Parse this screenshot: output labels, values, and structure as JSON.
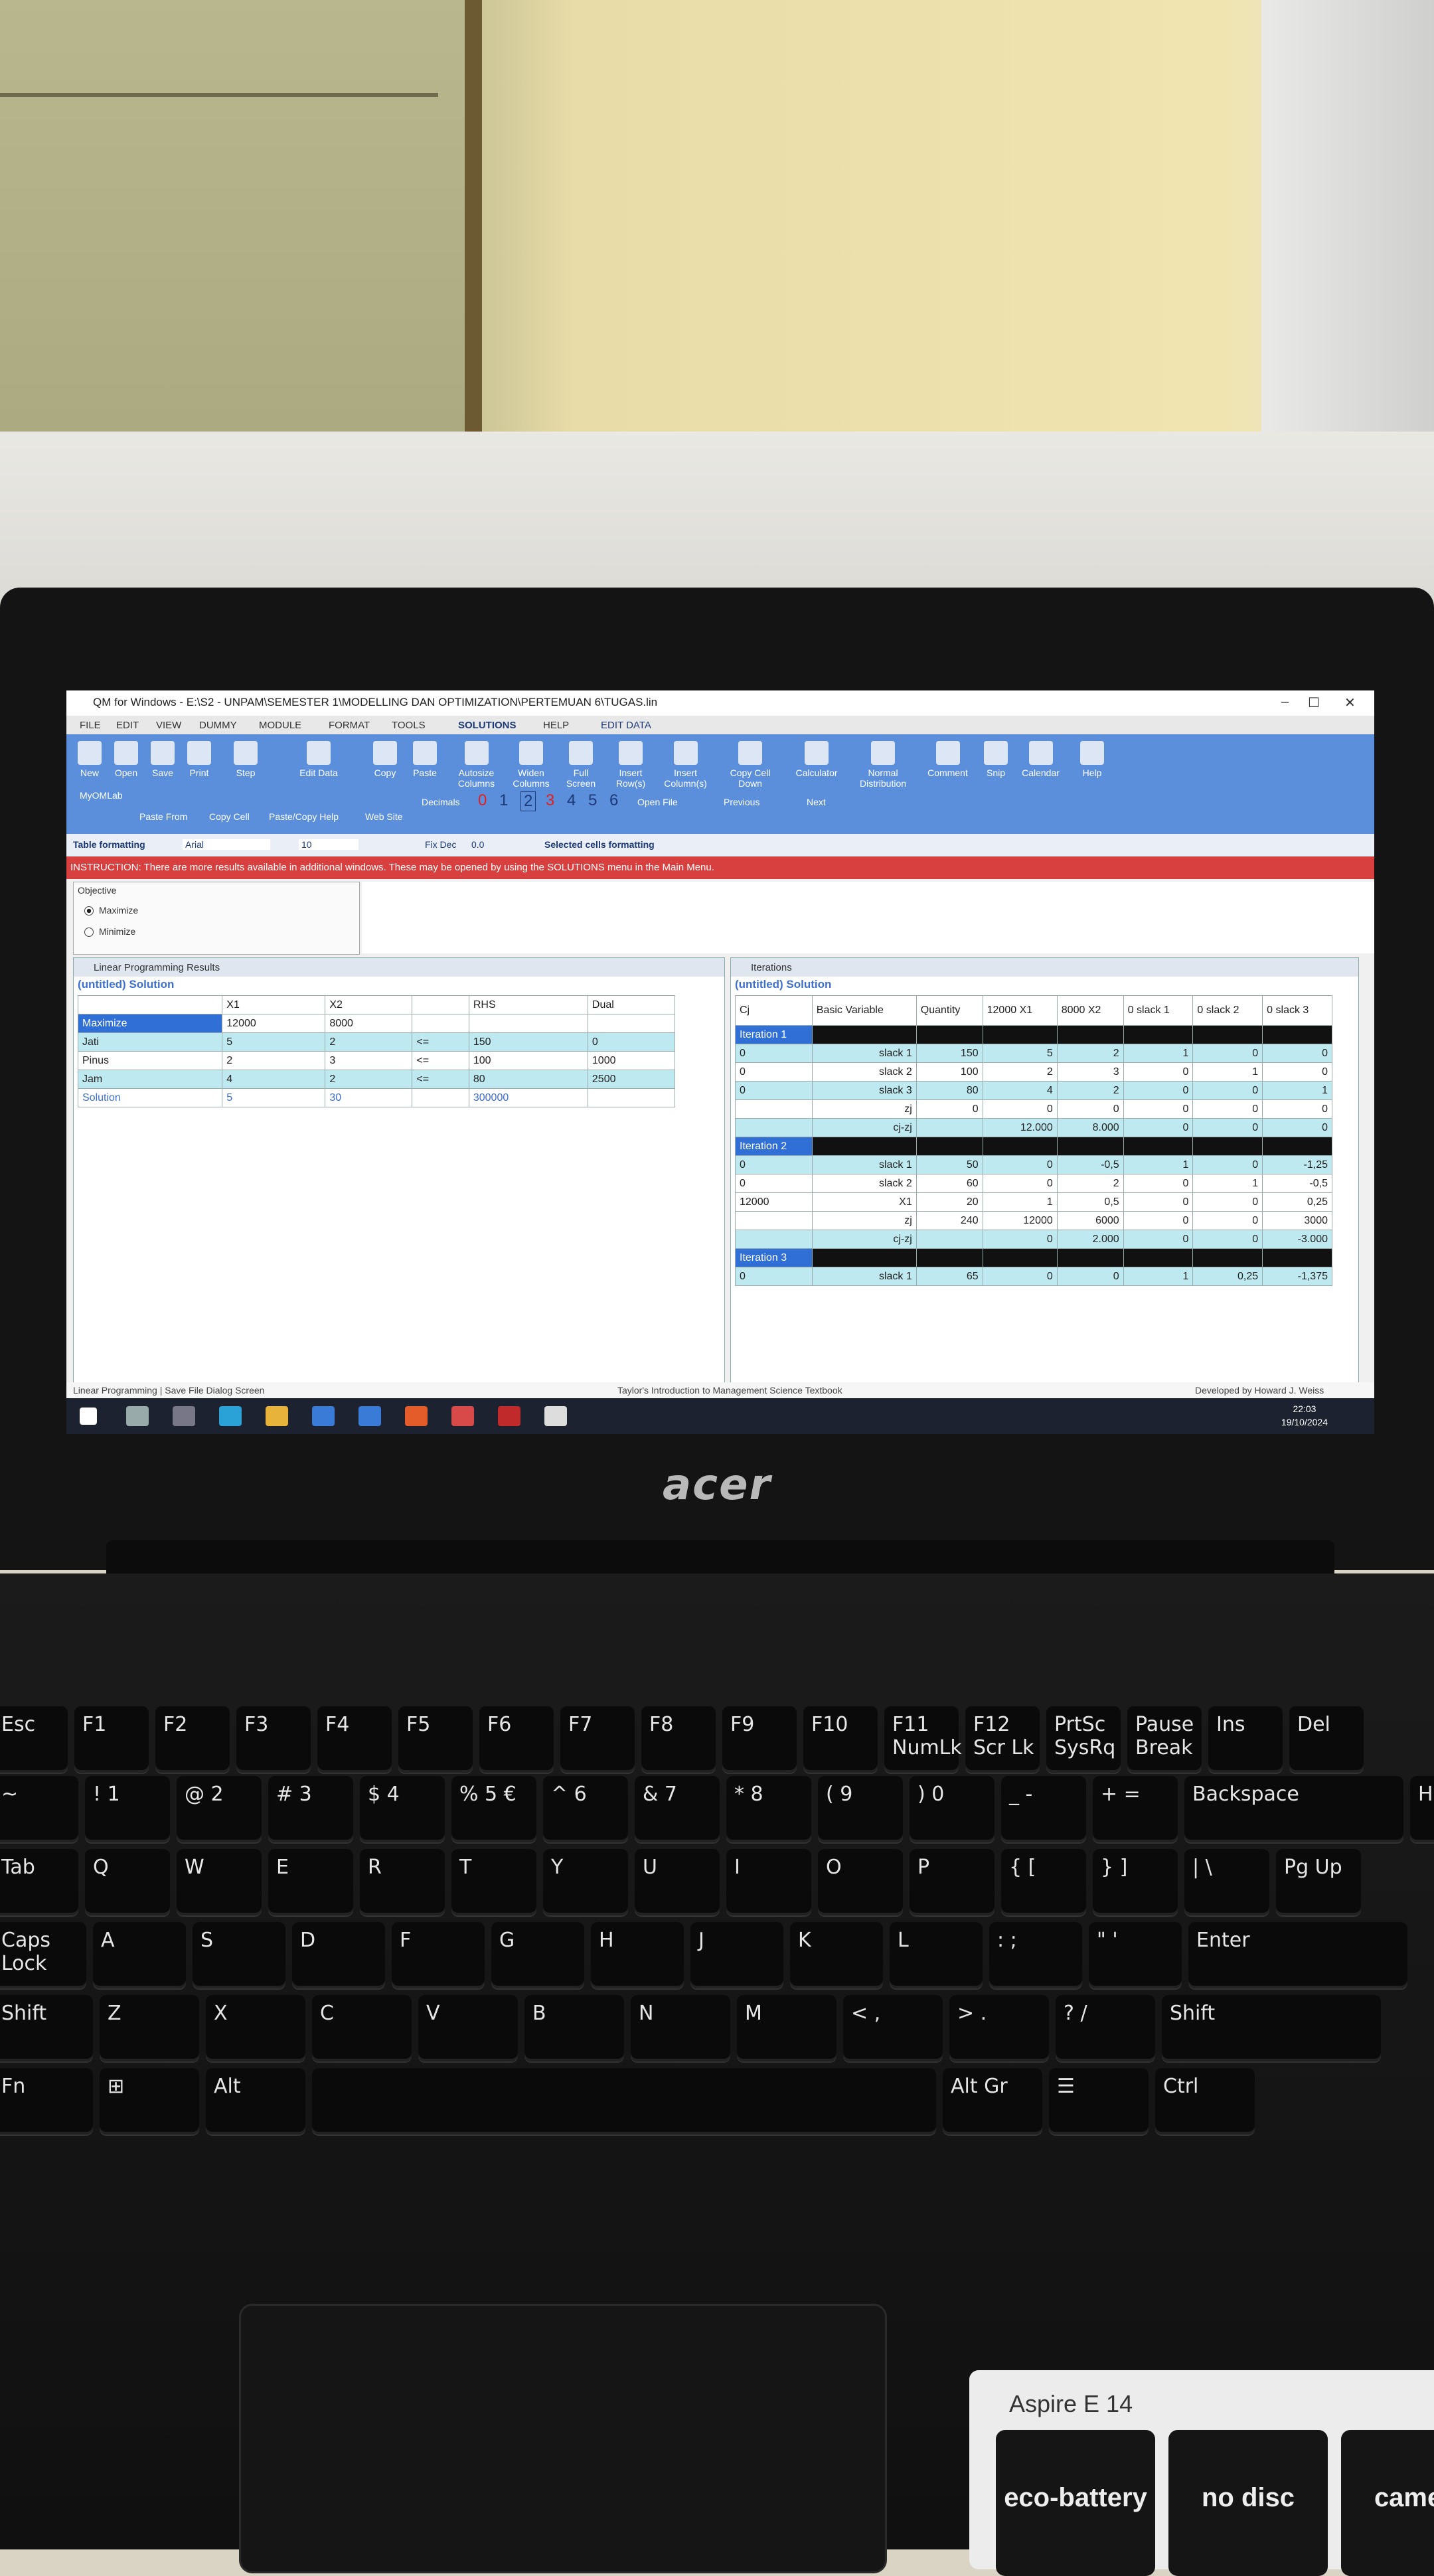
{
  "window": {
    "title": "QM for Windows - E:\\S2 - UNPAM\\SEMESTER 1\\MODELLING DAN OPTIMIZATION\\PERTEMUAN 6\\TUGAS.lin",
    "controls": [
      "–",
      "☐",
      "✕"
    ]
  },
  "menu": [
    "FILE",
    "EDIT",
    "VIEW",
    "DUMMY",
    "MODULE",
    "FORMAT",
    "TOOLS",
    "SOLUTIONS",
    "HELP",
    "EDIT DATA"
  ],
  "ribbon": {
    "buttons": [
      "New",
      "Open",
      "Save",
      "Print",
      "Step",
      "Edit Data",
      "Copy",
      "Paste",
      "Autosize Columns",
      "Widen Columns",
      "Full Screen",
      "Insert Row(s)",
      "Insert Column(s)",
      "Copy Cell Down",
      "Calculator",
      "Normal Distribution",
      "Comment",
      "Snip",
      "Calendar",
      "Help"
    ],
    "row2": [
      "MyOMLab",
      "Paste From",
      "Copy Cell",
      "Paste/Copy Help",
      "Web Site",
      "Decimals",
      "0",
      "1",
      "2",
      "3",
      "4",
      "5",
      "6",
      "Open File",
      "Previous",
      "Next"
    ]
  },
  "format_bar": {
    "label": "Table formatting",
    "font": "Arial",
    "size": "10",
    "fixdec": "Fix Dec",
    "dec_value": "0.0",
    "selected": "Selected cells formatting"
  },
  "instruction": "INSTRUCTION: There are more results available in additional windows. These may be opened by using the SOLUTIONS menu in the Main Menu.",
  "objective": {
    "title": "Objective",
    "options": [
      "Maximize",
      "Minimize"
    ],
    "selected": "Maximize"
  },
  "lp_results": {
    "title": "Linear Programming Results",
    "subtitle": "(untitled) Solution",
    "header": [
      "",
      "X1",
      "X2",
      "",
      "RHS",
      "Dual"
    ],
    "rows": [
      [
        "Maximize",
        "12000",
        "8000",
        "",
        "",
        ""
      ],
      [
        "Jati",
        "5",
        "2",
        "<=",
        "150",
        "0"
      ],
      [
        "Pinus",
        "2",
        "3",
        "<=",
        "100",
        "1000"
      ],
      [
        "Jam",
        "4",
        "2",
        "<=",
        "80",
        "2500"
      ],
      [
        "Solution",
        "5",
        "30",
        "",
        "300000",
        ""
      ]
    ]
  },
  "iterations": {
    "title": "Iterations",
    "subtitle": "(untitled) Solution",
    "header_top": [
      "Cj",
      "Basic Variable",
      "Quantity",
      "12000 X1",
      "8000 X2",
      "0 slack 1",
      "0 slack 2",
      "0 slack 3"
    ],
    "rows": [
      [
        "Iteration 1",
        "",
        "",
        "",
        "",
        "",
        "",
        ""
      ],
      [
        "0",
        "slack 1",
        "150",
        "5",
        "2",
        "1",
        "0",
        "0"
      ],
      [
        "0",
        "slack 2",
        "100",
        "2",
        "3",
        "0",
        "1",
        "0"
      ],
      [
        "0",
        "slack 3",
        "80",
        "4",
        "2",
        "0",
        "0",
        "1"
      ],
      [
        "",
        "zj",
        "0",
        "0",
        "0",
        "0",
        "0",
        "0"
      ],
      [
        "",
        "cj-zj",
        "",
        "12.000",
        "8.000",
        "0",
        "0",
        "0"
      ],
      [
        "Iteration 2",
        "",
        "",
        "",
        "",
        "",
        "",
        ""
      ],
      [
        "0",
        "slack 1",
        "50",
        "0",
        "-0,5",
        "1",
        "0",
        "-1,25"
      ],
      [
        "0",
        "slack 2",
        "60",
        "0",
        "2",
        "0",
        "1",
        "-0,5"
      ],
      [
        "12000",
        "X1",
        "20",
        "1",
        "0,5",
        "0",
        "0",
        "0,25"
      ],
      [
        "",
        "zj",
        "240",
        "12000",
        "6000",
        "0",
        "0",
        "3000"
      ],
      [
        "",
        "cj-zj",
        "",
        "0",
        "2.000",
        "0",
        "0",
        "-3.000"
      ],
      [
        "Iteration 3",
        "",
        "",
        "",
        "",
        "",
        "",
        ""
      ],
      [
        "0",
        "slack 1",
        "65",
        "0",
        "0",
        "1",
        "0,25",
        "-1,375"
      ]
    ]
  },
  "status": {
    "left": "Linear Programming | Save File Dialog Screen",
    "center": "Taylor's Introduction to Management Science Textbook",
    "right": "Developed by Howard J. Weiss"
  },
  "taskbar": {
    "time": "22:03",
    "date": "19/10/2024"
  },
  "laptop": {
    "brand": "acer",
    "model": "Aspire E 14",
    "sticker_icons": [
      "eco-battery",
      "no disc",
      "camera"
    ]
  },
  "keyboard": {
    "row1": [
      "Esc",
      "F1",
      "F2",
      "F3",
      "F4",
      "F5",
      "F6",
      "F7",
      "F8",
      "F9",
      "F10",
      "F11 NumLk",
      "F12 Scr Lk",
      "PrtSc SysRq",
      "Pause Break",
      "Ins",
      "Del"
    ],
    "row2": [
      "~",
      "! 1",
      "@ 2",
      "# 3",
      "$ 4",
      "% 5 €",
      "^ 6",
      "& 7",
      "* 8",
      "( 9",
      ") 0",
      "_ -",
      "+ =",
      "Backspace",
      "Home"
    ],
    "row3": [
      "Tab",
      "Q",
      "W",
      "E",
      "R",
      "T",
      "Y",
      "U",
      "I",
      "O",
      "P",
      "{ [",
      "} ]",
      "| \\",
      "Pg Up"
    ],
    "row4": [
      "Caps Lock",
      "A",
      "S",
      "D",
      "F",
      "G",
      "H",
      "J",
      "K",
      "L",
      ": ;",
      "\" '",
      "Enter"
    ],
    "row5": [
      "Shift",
      "Z",
      "X",
      "C",
      "V",
      "B",
      "N",
      "M",
      "< ,",
      "> .",
      "? /",
      "Shift"
    ],
    "row6": [
      "Fn",
      "⊞",
      "Alt",
      "",
      "Alt Gr",
      "☰",
      "Ctrl"
    ]
  }
}
